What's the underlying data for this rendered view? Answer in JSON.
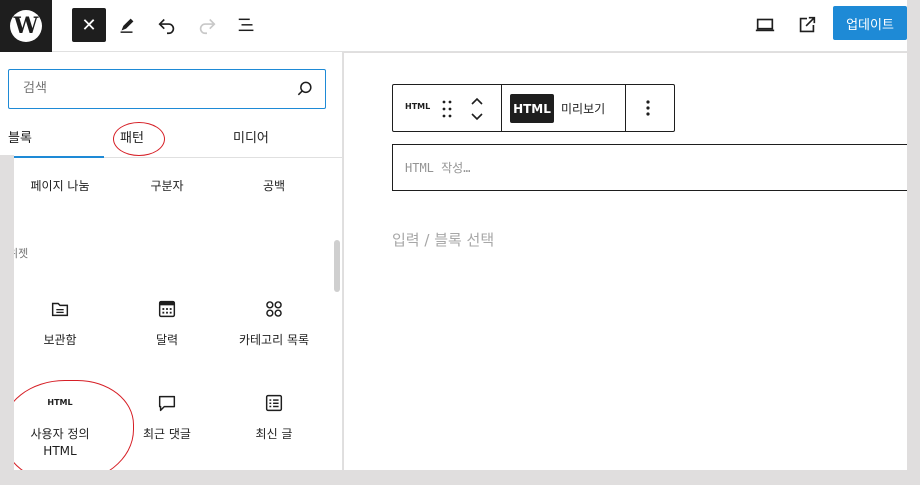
{
  "header": {
    "logo_letter": "W",
    "close_icon": "close-icon",
    "tools_icon": "pencil-icon",
    "undo_icon": "undo-icon",
    "redo_icon": "redo-icon",
    "outline_icon": "list-view-icon",
    "preview_icon": "desktop-icon",
    "external_icon": "external-link-icon",
    "update_label": "업데이트"
  },
  "inserter": {
    "search_placeholder": "검색",
    "tabs": [
      {
        "label": "블록"
      },
      {
        "label": "패턴"
      },
      {
        "label": "미디어"
      }
    ],
    "top_row": [
      {
        "label": "페이지 나눔"
      },
      {
        "label": "구분자"
      },
      {
        "label": "공백"
      }
    ],
    "section_label": "위젯",
    "widgets": [
      {
        "label": "보관함",
        "icon": "archive-icon"
      },
      {
        "label": "달력",
        "icon": "calendar-icon"
      },
      {
        "label": "카테고리 목록",
        "icon": "categories-icon"
      },
      {
        "label": "사용자 정의 HTML",
        "label_line1": "사용자 정의",
        "label_line2": "HTML",
        "icon": "html-icon"
      },
      {
        "label": "최근 댓글",
        "icon": "comment-icon"
      },
      {
        "label": "최신 글",
        "icon": "post-list-icon"
      }
    ]
  },
  "editor": {
    "toolbar": {
      "block_type": "HTML",
      "tab_html": "HTML",
      "tab_preview": "미리보기"
    },
    "html_placeholder": "HTML 작성…",
    "appender_placeholder": "입력 / 블록 선택"
  },
  "colors": {
    "accent": "#1e8ad6",
    "annotation": "#d61f26",
    "dark": "#1e1e1e"
  }
}
